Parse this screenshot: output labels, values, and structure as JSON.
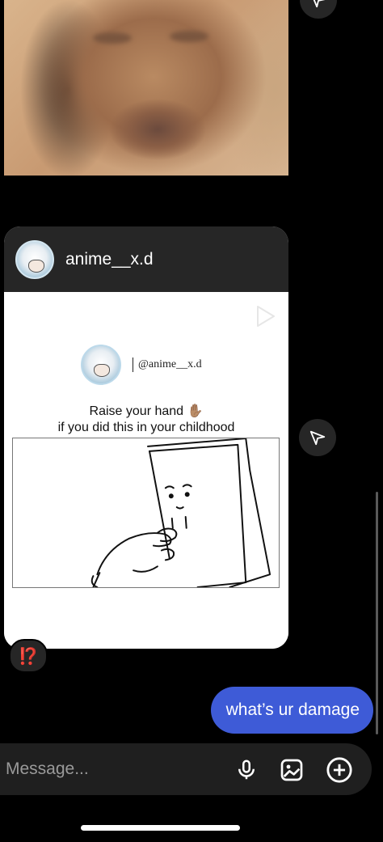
{
  "thread": {
    "top_image": {
      "icon": "blurred-face-photo"
    },
    "shared_post": {
      "username": "anime__x.d",
      "inner_handle": "@anime__x.d",
      "caption_line1": "Raise your hand ✋🏽",
      "caption_line2": "if you did this in your childhood",
      "play_icon": "play-icon",
      "reaction_emoji": "⁉️"
    },
    "sent_message": {
      "text": "what’s ur damage",
      "color": "#3e5bd7"
    }
  },
  "composer": {
    "placeholder": "Message...",
    "mic_icon": "microphone-icon",
    "gallery_icon": "image-icon",
    "add_icon": "plus-circle-icon"
  },
  "colors": {
    "background": "#000000",
    "surface": "#262626",
    "accent_bubble": "#3e5bd7",
    "reaction": "#ff3b30"
  }
}
